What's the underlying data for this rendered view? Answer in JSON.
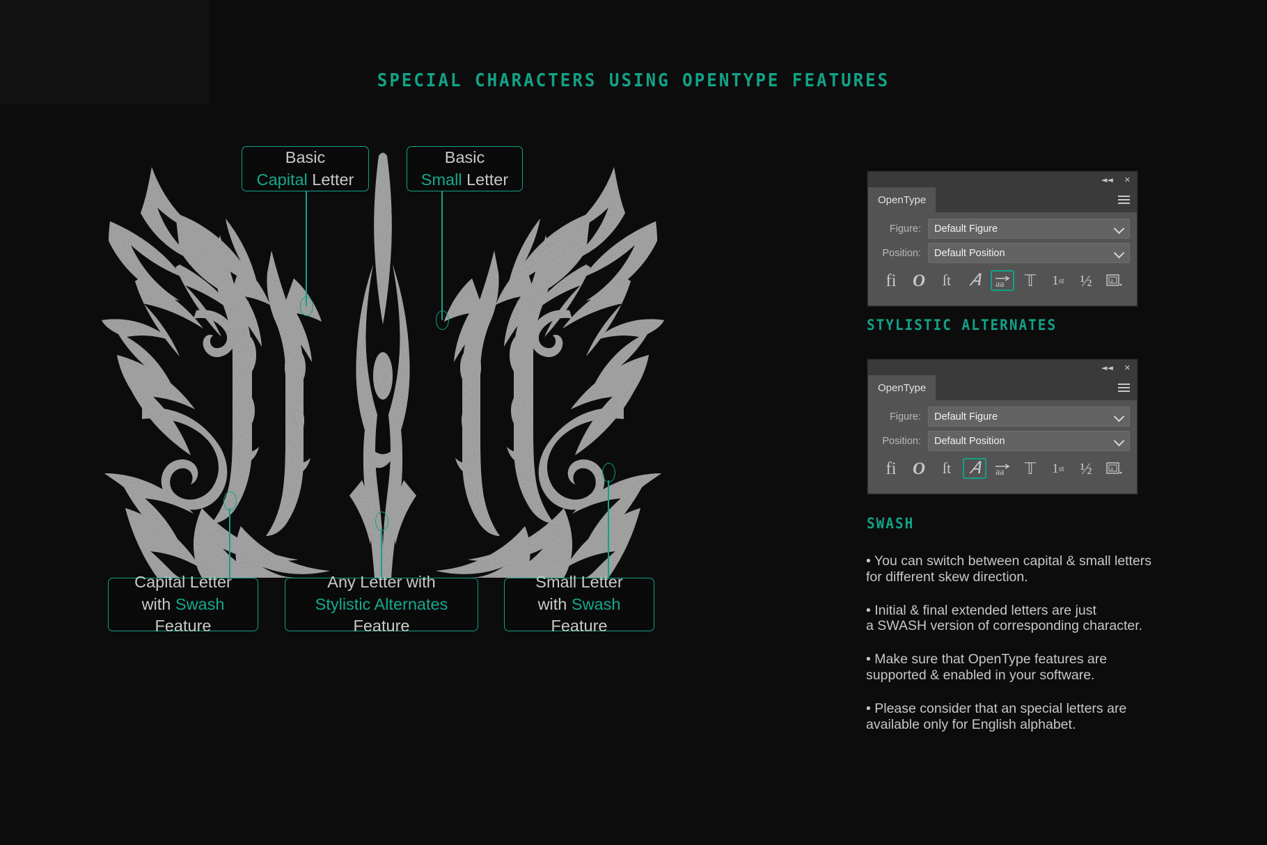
{
  "poster": {
    "title": "SPECIAL CHARACTERS USING OPENTYPE FEATURES",
    "background_color": "#0c0c0c",
    "accent_color": "#13a189",
    "text_color": "#c7c7c7",
    "artwork_color": "#b3b3b3",
    "artwork_alt": "Ornate blackletter tribal lettering artwork"
  },
  "callouts": {
    "top_left": {
      "line1": "Basic",
      "line2_highlight": "Capital",
      "line2_rest": " Letter"
    },
    "top_right": {
      "line1": "Basic",
      "line2_highlight": "Small",
      "line2_rest": " Letter"
    },
    "bottom_left": {
      "line1": "Capital Letter",
      "line2_pre": "with ",
      "line2_highlight": "Swash",
      "line2_rest": " Feature"
    },
    "bottom_center": {
      "line1": "Any Letter with",
      "line2_pre": "",
      "line2_highlight": "Stylistic Alternates",
      "line2_rest": " Feature"
    },
    "bottom_right": {
      "line1": "Small Letter",
      "line2_pre": "with ",
      "line2_highlight": "Swash",
      "line2_rest": " Feature"
    }
  },
  "panels": [
    {
      "id": "panel-stylistic-alternates",
      "tab_label": "OpenType",
      "collapse_icon": "collapse-icon",
      "close_icon": "close-icon",
      "menu_icon": "panel-menu-icon",
      "rows": [
        {
          "label": "Figure:",
          "value": "Default Figure"
        },
        {
          "label": "Position:",
          "value": "Default Position"
        }
      ],
      "icons": [
        {
          "name": "standard-ligatures-icon",
          "glyph": "fi",
          "active": false
        },
        {
          "name": "contextual-alternates-icon",
          "glyph": "O",
          "active": false
        },
        {
          "name": "discretionary-ligatures-icon",
          "glyph": "st",
          "active": false
        },
        {
          "name": "swash-icon",
          "glyph": "A",
          "active": false
        },
        {
          "name": "stylistic-alternates-icon",
          "glyph": "aa",
          "active": true
        },
        {
          "name": "titling-alternates-icon",
          "glyph": "T",
          "active": false
        },
        {
          "name": "ordinals-icon",
          "glyph": "1st",
          "active": false
        },
        {
          "name": "fractions-icon",
          "glyph": "½",
          "active": false
        },
        {
          "name": "stylistic-sets-icon",
          "glyph": "a",
          "active": false
        }
      ],
      "caption": "STYLISTIC ALTERNATES"
    },
    {
      "id": "panel-swash",
      "tab_label": "OpenType",
      "collapse_icon": "collapse-icon",
      "close_icon": "close-icon",
      "menu_icon": "panel-menu-icon",
      "rows": [
        {
          "label": "Figure:",
          "value": "Default Figure"
        },
        {
          "label": "Position:",
          "value": "Default Position"
        }
      ],
      "icons": [
        {
          "name": "standard-ligatures-icon",
          "glyph": "fi",
          "active": false
        },
        {
          "name": "contextual-alternates-icon",
          "glyph": "O",
          "active": false
        },
        {
          "name": "discretionary-ligatures-icon",
          "glyph": "st",
          "active": false
        },
        {
          "name": "swash-icon",
          "glyph": "A",
          "active": true
        },
        {
          "name": "stylistic-alternates-icon",
          "glyph": "aa",
          "active": false
        },
        {
          "name": "titling-alternates-icon",
          "glyph": "T",
          "active": false
        },
        {
          "name": "ordinals-icon",
          "glyph": "1st",
          "active": false
        },
        {
          "name": "fractions-icon",
          "glyph": "½",
          "active": false
        },
        {
          "name": "stylistic-sets-icon",
          "glyph": "a",
          "active": false
        }
      ],
      "caption": "SWASH"
    }
  ],
  "notes": [
    "• You can switch between capital & small letters\nfor different skew direction.",
    "• Initial & final extended letters are just\na SWASH version of corresponding character.",
    "• Make sure that OpenType features are\nsupported & enabled in your software.",
    "• Please  consider that an special letters are\navailable only for English alphabet."
  ]
}
